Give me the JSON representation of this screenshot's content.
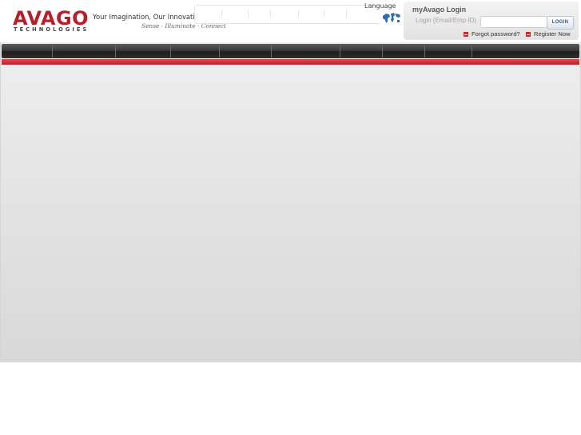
{
  "brand": {
    "logo_word": "AVAGO",
    "logo_sub": "TECHNOLOGIES",
    "tagline": "Your Imagination, Our Innovation",
    "subtagline": "Sense · Illuminate · Connect",
    "color": "#b71f2b"
  },
  "language": {
    "label": "Language",
    "icon": "globe-icon"
  },
  "login": {
    "title": "myAvago Login",
    "field_label": "Login (Email/Emp ID)",
    "field_value": "",
    "button_label": "LOGIN",
    "forgot_label": "Forgot password?",
    "register_label": "Register Now"
  },
  "colors": {
    "accent_red": "#c8282e",
    "nav_dark": "#2a2a2a"
  }
}
